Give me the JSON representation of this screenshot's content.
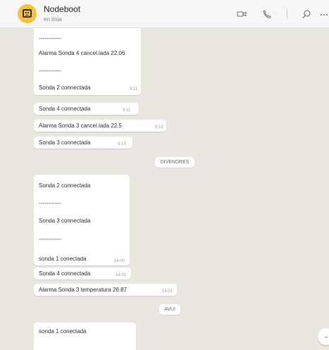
{
  "header": {
    "title": "Nodeboot",
    "subtitle": "en línia",
    "icons": [
      "bot-avatar",
      "video-call-icon",
      "phone-icon",
      "search-icon",
      "more-icon"
    ]
  },
  "messages": {
    "m1": {
      "lines": [
        "------------",
        "Alarma Sonda 4 cancel.lada 22.06",
        "------------",
        "Sonda 2 connectada"
      ],
      "time": "9:11"
    },
    "m2": {
      "text": "Sonda 4  connectada",
      "time": "9:11"
    },
    "m3": {
      "text": "Alarma Sonda 3 cancel.lada 22.5",
      "time": "9:13"
    },
    "m4": {
      "text": "Sonda 3 connectada",
      "time": "9:13"
    },
    "date1": "DIVENDRES",
    "m5": {
      "lines": [
        "Sonda 2 connectada",
        "------------",
        "Sonda 3 connectada",
        "------------",
        "sonda 1 conectada"
      ],
      "time": "14:00"
    },
    "m6": {
      "text": "Sonda 4  connectada",
      "time": "14:01"
    },
    "m7": {
      "text": "Alarma Sonda 3 temperatura 26.87",
      "time": "14:01"
    },
    "date2": "AVUI",
    "m8": {
      "text": "sonda 1 conectada"
    }
  },
  "scroll_button": {
    "glyph": "⌄"
  },
  "colors": {
    "chat_bg": "#eae6e0",
    "bubble": "#ffffff",
    "avatar": "#f5c33b"
  }
}
